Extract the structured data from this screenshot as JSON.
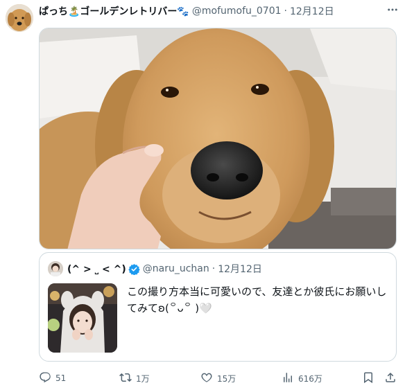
{
  "post": {
    "author_name": "ぱっち🏝️ゴールデンレトリバー🐾",
    "author_handle": "@mofumofu_0701",
    "separator": "·",
    "date": "12月12日"
  },
  "quoted_post": {
    "author_name": "(^ > ˽ < ^)",
    "author_handle": "@naru_uchan",
    "separator": "·",
    "date": "12月12日",
    "text": "この撮り方本当に可愛いので、友達とか彼氏にお願いしてみて",
    "text_suffix": "ʚ(꒪ᴗ꒪ )",
    "text_heart": "🤍"
  },
  "actions": {
    "replies": "51",
    "reposts": "1万",
    "likes": "15万",
    "views": "616万"
  },
  "icons": {
    "more": "more-icon",
    "verified": "verified-badge-icon",
    "reply": "reply-icon",
    "repost": "repost-icon",
    "like": "heart-icon",
    "views": "views-icon",
    "bookmark": "bookmark-icon",
    "share": "share-icon"
  },
  "colors": {
    "text_primary": "#0f1419",
    "text_secondary": "#536471",
    "border": "#cfd9de",
    "verified": "#1d9bf0"
  }
}
